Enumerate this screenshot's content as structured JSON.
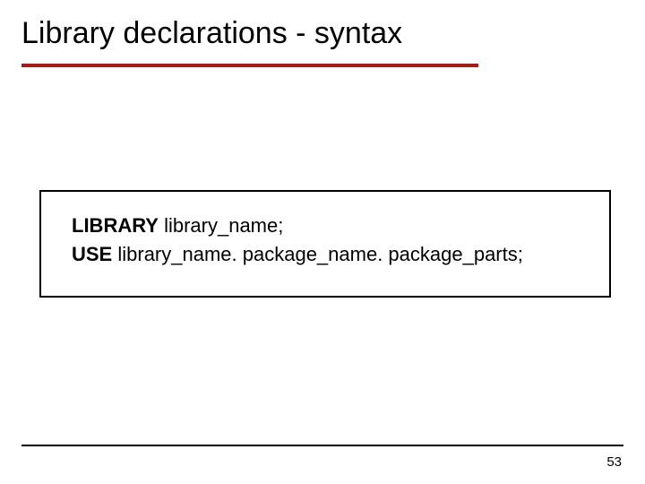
{
  "slide": {
    "title": "Library declarations - syntax",
    "code": {
      "kw1": "LIBRARY",
      "rest1": "  library_name;",
      "kw2": "USE",
      "rest2": " library_name. package_name. package_parts;"
    },
    "page_number": "53"
  }
}
